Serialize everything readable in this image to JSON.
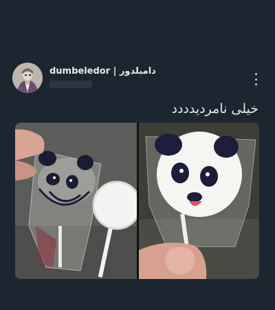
{
  "tweet": {
    "author_name": "dumbeledor | دامبلدور",
    "text": "خیلی نامردیدددد",
    "avatar_icon": "wizard-avatar-icon",
    "more_icon": "more-vertical-icon"
  },
  "media": {
    "photos": [
      {
        "subject": "panda-lollipop-wrapped"
      },
      {
        "subject": "panda-lollipop-wrapped"
      }
    ]
  },
  "colors": {
    "background": "#1c2630",
    "text": "#e7e9ea",
    "muted": "#2b3640"
  }
}
